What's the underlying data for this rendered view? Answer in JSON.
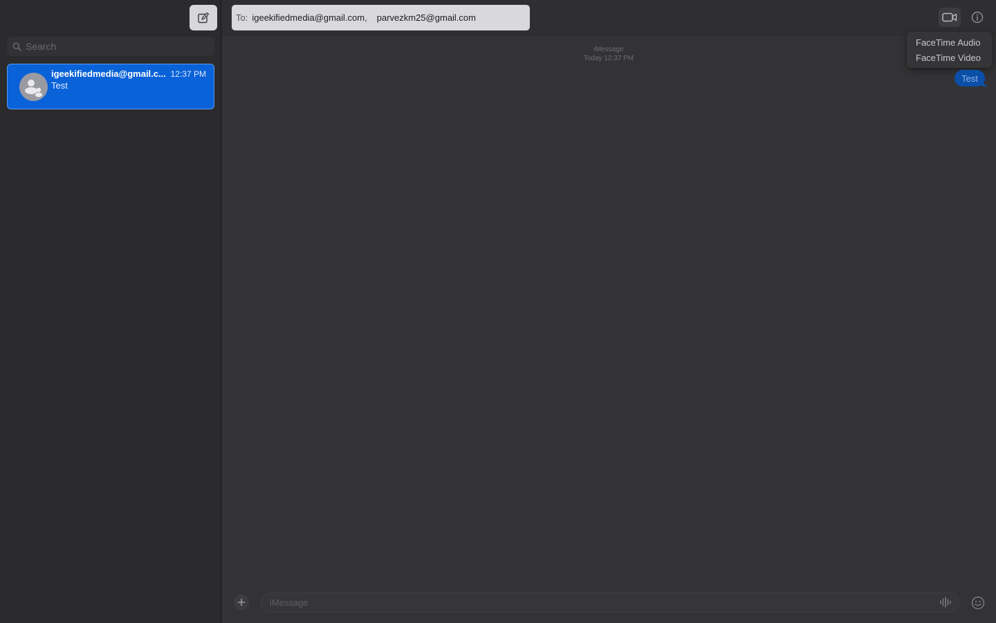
{
  "sidebar": {
    "compose_icon": "compose-icon",
    "search": {
      "placeholder": "Search",
      "icon": "search-icon"
    },
    "conversations": [
      {
        "name": "igeekifiedmedia@gmail.c...",
        "time": "12:37 PM",
        "preview": "Test",
        "avatar_icon": "group-avatar-icon",
        "selected": true
      }
    ]
  },
  "header": {
    "to_label": "To:",
    "recipients": [
      "igeekifiedmedia@gmail.com",
      "parvezkm25@gmail.com"
    ],
    "recipient_separator": ",",
    "video_icon": "video-camera-icon",
    "info_icon": "info-icon"
  },
  "facetime_menu": {
    "items": [
      "FaceTime Audio",
      "FaceTime Video"
    ]
  },
  "thread": {
    "service": "iMessage",
    "timestamp": "Today 12:37 PM",
    "messages": [
      {
        "text": "Test",
        "direction": "outgoing"
      }
    ]
  },
  "composer": {
    "placeholder": "iMessage",
    "value": "",
    "add_icon": "plus-icon",
    "audio_icon": "waveform-icon",
    "emoji_icon": "emoji-icon"
  },
  "colors": {
    "accent": "#0a62d8",
    "sidebar_bg": "#2b2b2d",
    "main_bg": "#333335",
    "bubble": "#0a4fa8"
  }
}
